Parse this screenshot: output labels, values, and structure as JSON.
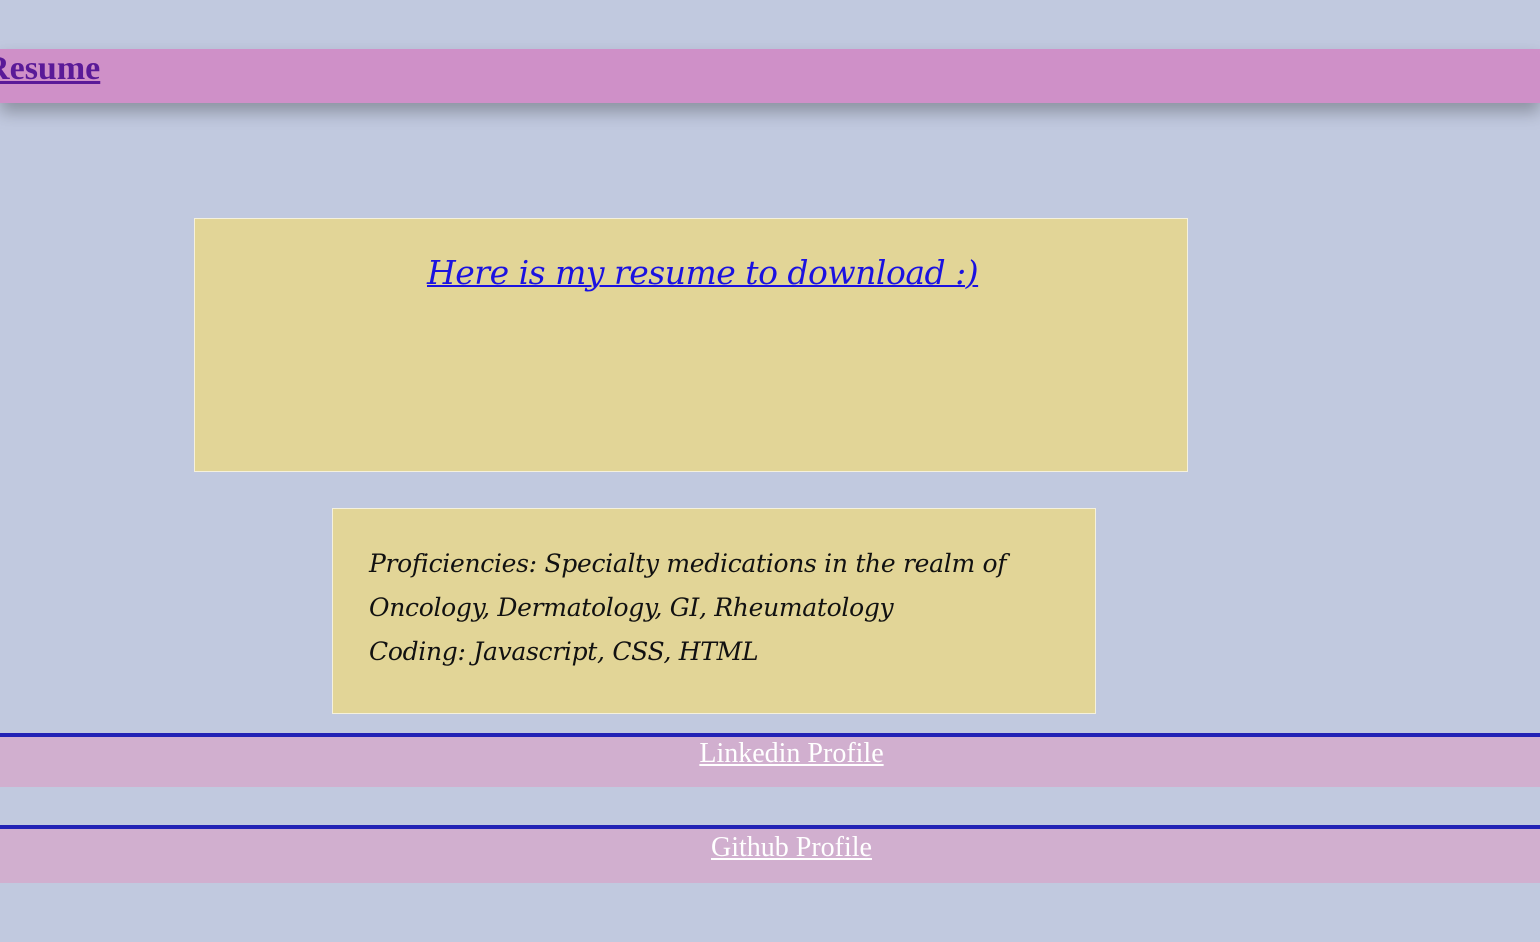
{
  "header": {
    "brand_link": "ReactResume"
  },
  "resume_card": {
    "download_link": "Here is my resume to download :)"
  },
  "skills_card": {
    "lines": [
      "Proficiencies: Specialty medications in the realm of",
      "Oncology, Dermatology, GI, Rheumatology",
      "Coding: Javascript, CSS, HTML"
    ]
  },
  "footer": {
    "linkedin_link": "Linkedin Profile",
    "github_link": "Github Profile"
  },
  "colors": {
    "page_background": "#c1c9df",
    "header_background": "#cf90c8",
    "header_link": "#5a1a98",
    "card_background": "#e2d597",
    "download_link": "#1b12e0",
    "footer_background": "#d1afcf",
    "footer_border": "#2222b5",
    "footer_link": "#ffffff"
  }
}
